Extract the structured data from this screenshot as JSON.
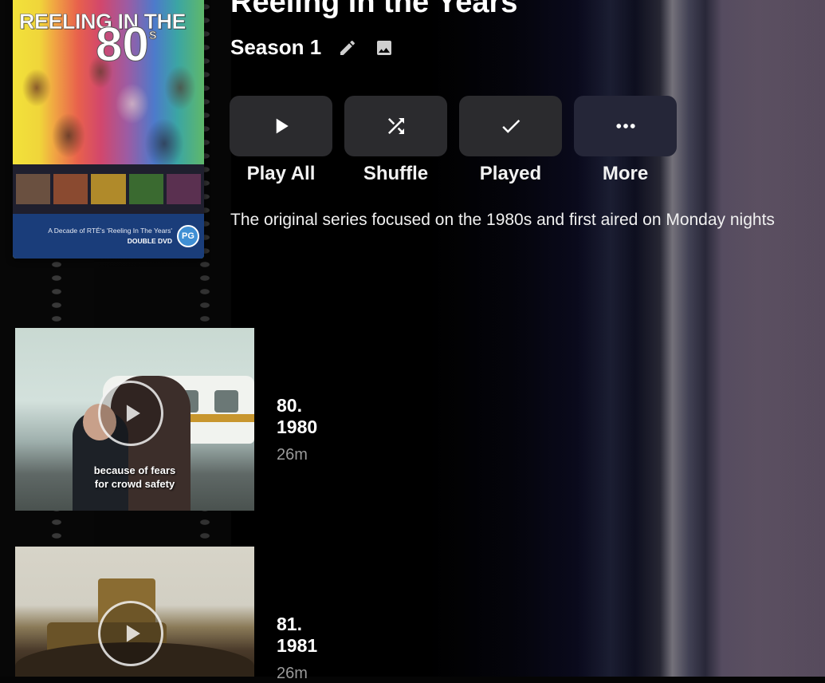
{
  "series": {
    "title": "Reeling in the Years"
  },
  "poster": {
    "title_line1": "REELING IN THE",
    "title_line2": "80",
    "title_suffix": "s",
    "tagline": "A Decade of RTÉ's 'Reeling In The Years'",
    "format": "DOUBLE DVD",
    "rating": "PG"
  },
  "season": {
    "name": "Season 1",
    "edit_icon": "pencil-icon",
    "image_icon": "image-icon"
  },
  "actions": [
    {
      "label": "Play All",
      "icon": "play-icon"
    },
    {
      "label": "Shuffle",
      "icon": "shuffle-icon"
    },
    {
      "label": "Played",
      "icon": "check-icon"
    },
    {
      "label": "More",
      "icon": "more-horizontal-icon"
    }
  ],
  "overview": "The original series focused on the 1980s and first aired on Monday nights",
  "episodes": [
    {
      "title": "80. 1980",
      "runtime": "26m",
      "subtitle_line1": "because of fears",
      "subtitle_line2": "for crowd safety"
    },
    {
      "title": "81. 1981",
      "runtime": "26m"
    }
  ]
}
